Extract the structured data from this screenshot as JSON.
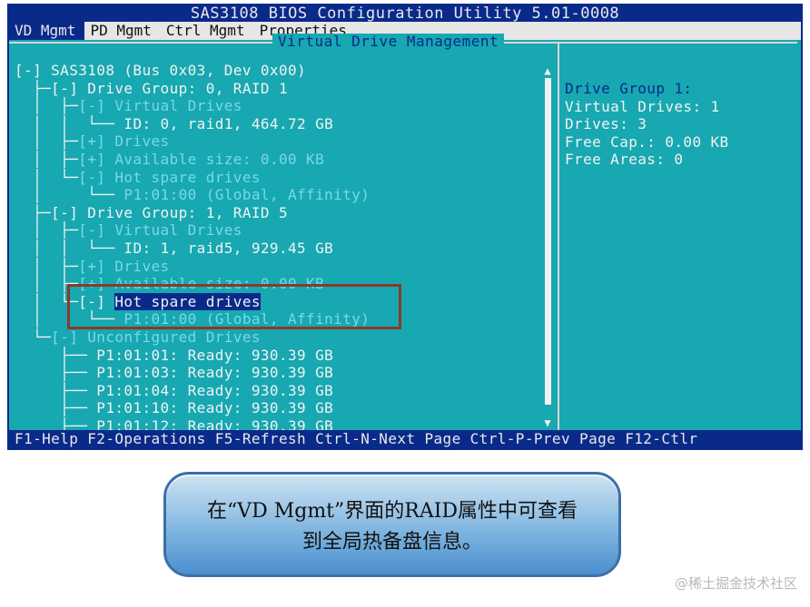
{
  "window": {
    "title": "SAS3108 BIOS Configuration Utility 5.01-0008"
  },
  "tabs": [
    {
      "label": "VD Mgmt",
      "active": true
    },
    {
      "label": "PD Mgmt",
      "active": false
    },
    {
      "label": "Ctrl Mgmt",
      "active": false
    },
    {
      "label": "Properties",
      "active": false
    }
  ],
  "panel": {
    "title": "Virtual Drive Management"
  },
  "tree": {
    "controller": "[-] SAS3108 (Bus 0x03, Dev 0x00)",
    "dg0": {
      "header": "[-] Drive Group: 0, RAID 1",
      "vd_header": "[-] Virtual Drives",
      "vd_item": "ID: 0, raid1, 464.72 GB",
      "drives": "[+] Drives",
      "available": "[+] Available size: 0.00 KB",
      "hotspare_header": "[-] Hot spare drives",
      "hotspare_item": "P1:01:00 (Global, Affinity)"
    },
    "dg1": {
      "header": "[-] Drive Group: 1, RAID 5",
      "vd_header": "[-] Virtual Drives",
      "vd_item": "ID: 1, raid5, 929.45 GB",
      "drives": "[+] Drives",
      "available": "[+] Available size: 0.00 KB",
      "hotspare_prefix": "[-] ",
      "hotspare_label": "Hot spare drives",
      "hotspare_item": "P1:01:00 (Global, Affinity)"
    },
    "unconfigured": {
      "header": "[-] Unconfigured Drives",
      "items": [
        "P1:01:01: Ready: 930.39 GB",
        "P1:01:03: Ready: 930.39 GB",
        "P1:01:04: Ready: 930.39 GB",
        "P1:01:10: Ready: 930.39 GB",
        "P1:01:12: Ready: 930.39 GB"
      ]
    }
  },
  "details": {
    "heading": "Drive Group 1:",
    "virtual_drives": "Virtual Drives: 1",
    "drives": "Drives: 3",
    "free_cap": "Free Cap.: 0.00 KB",
    "free_areas": "Free Areas: 0"
  },
  "statusbar": {
    "text": "F1-Help F2-Operations F5-Refresh Ctrl-N-Next Page Ctrl-P-Prev Page F12-Ctlr"
  },
  "scrollbar": {
    "up": "▲",
    "down": "▼"
  },
  "callout": {
    "line1": "在“VD Mgmt”界面的RAID属性中可查看",
    "line2": "到全局热备盘信息。"
  },
  "watermark": "@稀土掘金技术社区",
  "colors": {
    "background": "#17a8b1",
    "title_bar": "#0a2a8a",
    "dim_text": "#7ad8e8",
    "highlight_box": "#8a3a2a",
    "callout": "#7ab2de"
  }
}
